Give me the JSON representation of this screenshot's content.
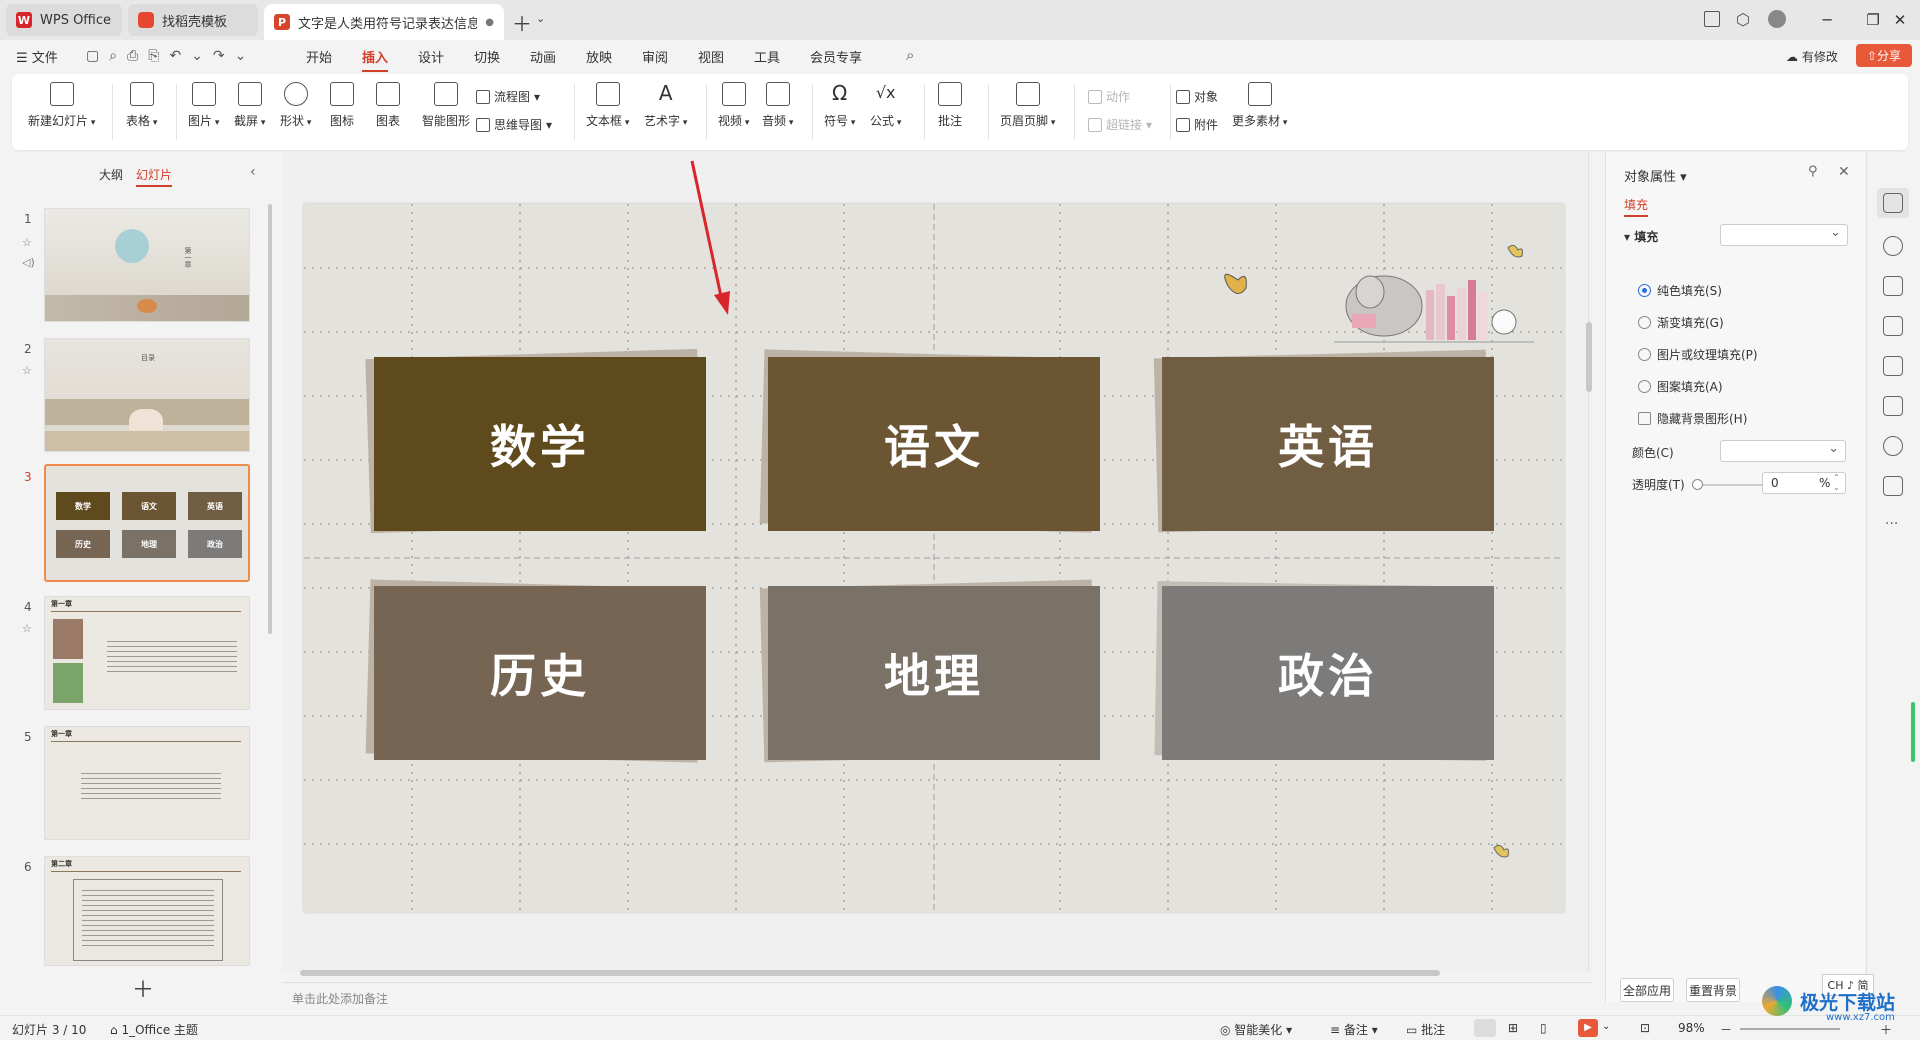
{
  "tabs": [
    {
      "label": "WPS Office",
      "icon": "wps-logo-icon"
    },
    {
      "label": "找稻壳模板",
      "icon": "docer-logo-icon"
    },
    {
      "label": "文字是人类用符号记录表达信息以",
      "icon": "ppt-logo-icon"
    }
  ],
  "menu": {
    "file": "文件",
    "items": [
      "开始",
      "插入",
      "设计",
      "切换",
      "动画",
      "放映",
      "审阅",
      "视图",
      "工具",
      "会员专享"
    ],
    "active": "插入",
    "has_changes": "有修改",
    "share": "分享"
  },
  "ribbon": {
    "new_slide": "新建幻灯片",
    "table": "表格",
    "picture": "图片",
    "screenshot": "截屏",
    "shape": "形状",
    "icon": "图标",
    "chart": "图表",
    "smart_art": "智能图形",
    "flowchart": "流程图",
    "mindmap": "思维导图",
    "textbox": "文本框",
    "wordart": "艺术字",
    "video": "视频",
    "audio": "音频",
    "symbol": "符号",
    "formula": "公式",
    "comment": "批注",
    "header_footer": "页眉页脚",
    "action": "动作",
    "hyperlink": "超链接",
    "object": "对象",
    "attachment": "附件",
    "more": "更多素材"
  },
  "left_panel": {
    "outline_tab": "大纲",
    "slides_tab": "幻灯片",
    "slide_numbers": [
      "1",
      "2",
      "3",
      "4",
      "5",
      "6"
    ],
    "thumb3_labels": [
      "数学",
      "语文",
      "英语",
      "历史",
      "地理",
      "政治"
    ],
    "thumb_chapter": "第一章",
    "thumb_chapter2": "第二章",
    "thumb2_title": "目录"
  },
  "slide": {
    "cards": [
      {
        "label": "数学",
        "color": "#5f4a1e"
      },
      {
        "label": "语文",
        "color": "#6b5533"
      },
      {
        "label": "英语",
        "color": "#715d42"
      },
      {
        "label": "历史",
        "color": "#776554"
      },
      {
        "label": "地理",
        "color": "#7a7167"
      },
      {
        "label": "政治",
        "color": "#7c7b7a"
      }
    ],
    "notes_placeholder": "单击此处添加备注"
  },
  "properties": {
    "title": "对象属性",
    "fill_tab": "填充",
    "fill_section": "填充",
    "options": [
      "纯色填充(S)",
      "渐变填充(G)",
      "图片或纹理填充(P)",
      "图案填充(A)"
    ],
    "selected_option": "纯色填充(S)",
    "hide_bg": "隐藏背景图形(H)",
    "color_label": "颜色(C)",
    "transparency_label": "透明度(T)",
    "transparency_value": "0",
    "transparency_unit": "%",
    "apply_all": "全部应用",
    "reset_bg": "重置背景"
  },
  "status": {
    "slide_info": "幻灯片 3 / 10",
    "theme": "1_Office 主题",
    "smart_beautify": "智能美化",
    "notes": "备注",
    "comments": "批注",
    "zoom": "98%",
    "ime": "CH ♪ 简"
  },
  "watermark": {
    "text": "极光下载站",
    "url": "www.xz7.com"
  },
  "colors": {
    "accent": "#d0402a",
    "arrow": "#d9262c"
  }
}
